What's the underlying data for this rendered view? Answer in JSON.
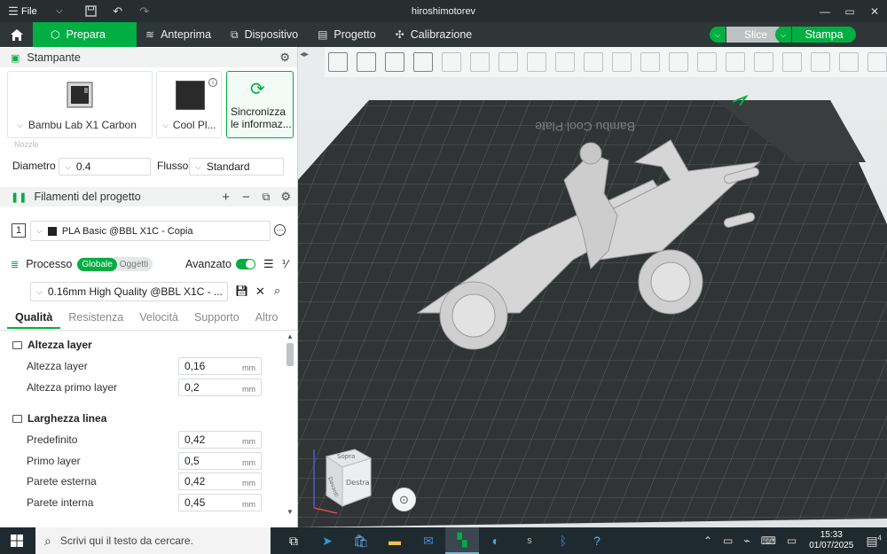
{
  "window": {
    "title": "hiroshimotorev",
    "menu_file": "File"
  },
  "tabs": [
    {
      "label": "Prepara"
    },
    {
      "label": "Anteprima"
    },
    {
      "label": "Dispositivo"
    },
    {
      "label": "Progetto"
    },
    {
      "label": "Calibrazione"
    }
  ],
  "actions": {
    "slice": "Slice",
    "stampa": "Stampa"
  },
  "printer": {
    "section_title": "Stampante",
    "printer_name": "Bambu Lab X1 Carbon",
    "plate_name": "Cool Pl...",
    "sync_label_1": "Sincronizza",
    "sync_label_2": "le informaz...",
    "nozzle_label": "Nozzle",
    "diametro_label": "Diametro",
    "diametro_value": "0.4",
    "flusso_label": "Flusso",
    "flusso_value": "Standard"
  },
  "filaments": {
    "section_title": "Filamenti del progetto",
    "items": [
      {
        "index": "1",
        "name": "PLA Basic @BBL X1C - Copia",
        "color": "#222222"
      }
    ]
  },
  "process": {
    "section_title": "Processo",
    "toggle_global": "Globale",
    "toggle_objects": "Oggetti",
    "advanced_label": "Avanzato",
    "preset": "0.16mm High Quality @BBL X1C - ...",
    "tabs": [
      "Qualità",
      "Resistenza",
      "Velocità",
      "Supporto",
      "Altro"
    ]
  },
  "groups": [
    {
      "title": "Altezza layer",
      "rows": [
        {
          "label": "Altezza layer",
          "value": "0,16",
          "unit": "mm"
        },
        {
          "label": "Altezza primo layer",
          "value": "0,2",
          "unit": "mm"
        }
      ]
    },
    {
      "title": "Larghezza linea",
      "rows": [
        {
          "label": "Predefinito",
          "value": "0,42",
          "unit": "mm"
        },
        {
          "label": "Primo layer",
          "value": "0,5",
          "unit": "mm"
        },
        {
          "label": "Parete esterna",
          "value": "0,42",
          "unit": "mm"
        },
        {
          "label": "Parete interna",
          "value": "0,45",
          "unit": "mm"
        }
      ]
    }
  ],
  "viewport": {
    "plate_text": "Bambu Cool Plate",
    "cube_top": "Sopra",
    "cube_front": "Davanti",
    "cube_right": "Destra"
  },
  "taskbar": {
    "search_placeholder": "Scrivi qui il testo da cercare.",
    "time": "15:33",
    "date": "01/07/2025",
    "notifications": "4"
  },
  "colors": {
    "accent": "#00ae42",
    "titlebar": "#262e30",
    "tabbar": "#2e3638",
    "plate": "#2f3233"
  }
}
